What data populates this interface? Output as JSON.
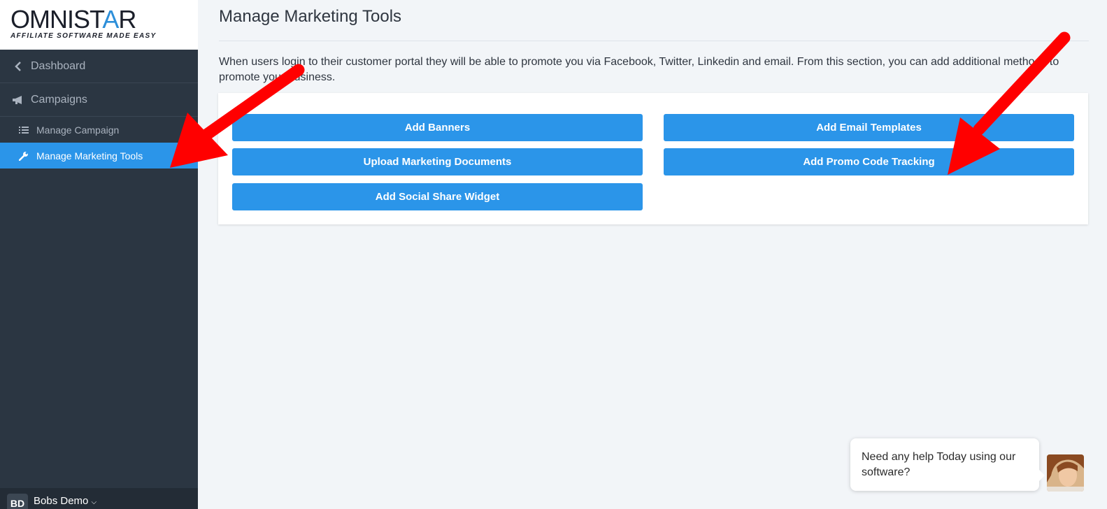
{
  "brand": {
    "name_prefix": "OMNIST",
    "name_star": "A",
    "name_suffix": "R",
    "tagline": "AFFILIATE SOFTWARE MADE EASY"
  },
  "sidebar": {
    "dashboard_label": "Dashboard",
    "campaigns_label": "Campaigns",
    "items": [
      {
        "label": "Manage Campaign",
        "icon": "list-icon",
        "active": false
      },
      {
        "label": "Manage Marketing Tools",
        "icon": "wrench-icon",
        "active": true
      }
    ]
  },
  "user": {
    "initials": "BD",
    "name": "Bobs Demo"
  },
  "main": {
    "title": "Manage Marketing Tools",
    "intro": "When users login to their customer portal they will be able to promote you via Facebook, Twitter, Linkedin and email. From this section, you can add additional methods to promote your business.",
    "buttons": {
      "add_banners": "Add Banners",
      "add_email_templates": "Add Email Templates",
      "upload_marketing_documents": "Upload Marketing Documents",
      "add_promo_code_tracking": "Add Promo Code Tracking",
      "add_social_share_widget": "Add Social Share Widget"
    }
  },
  "chat": {
    "message": "Need any help Today using our software?"
  },
  "colors": {
    "accent": "#2b95e9",
    "sidebar_bg": "#2b3642",
    "annotation_arrow": "#ff0000"
  }
}
